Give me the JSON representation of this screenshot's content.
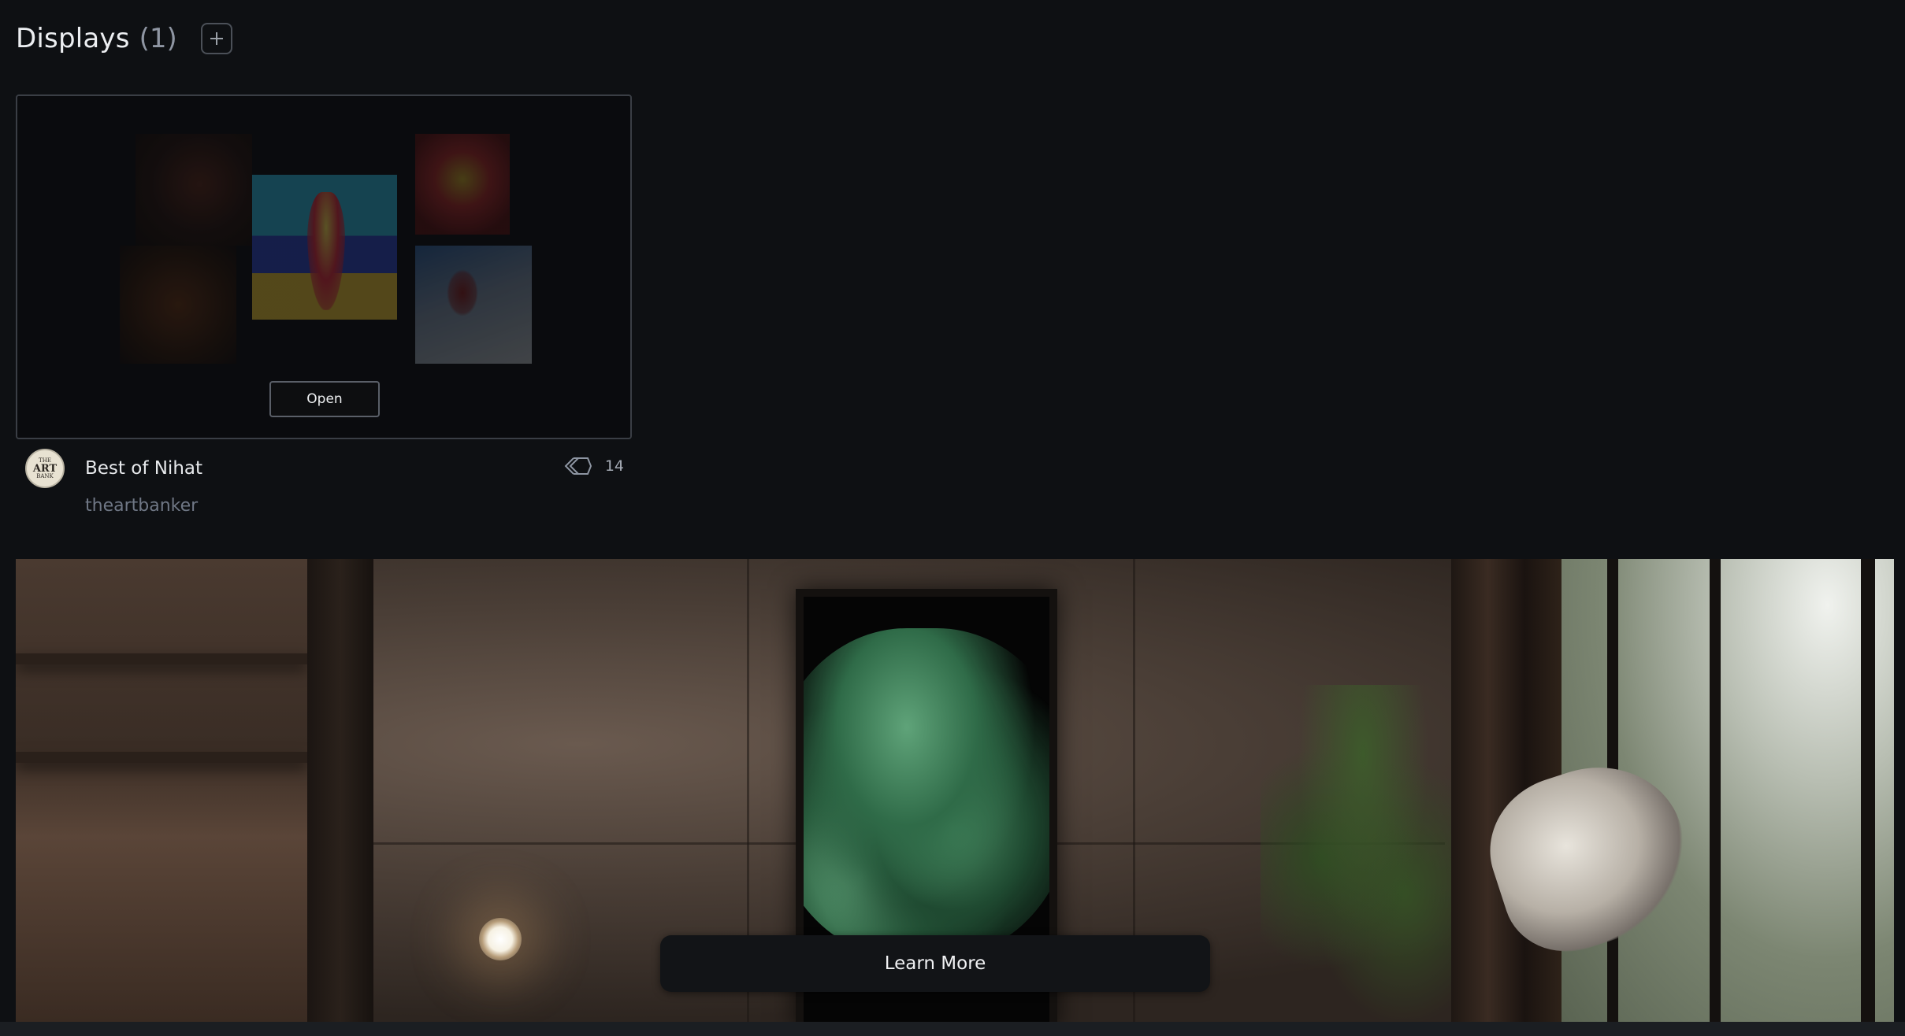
{
  "header": {
    "title": "Displays",
    "count": "(1)",
    "add_icon": "plus-icon"
  },
  "display_card": {
    "open_label": "Open",
    "name": "Best of Nihat",
    "owner": "theartbanker",
    "item_count": "14",
    "count_icon": "stack-chevrons-icon",
    "avatar": {
      "line1": "THE",
      "line2": "ART",
      "line3": "BANK"
    }
  },
  "banner": {
    "button_label": "Learn More"
  },
  "colors": {
    "background": "#0e1013",
    "muted_text": "#6f7785",
    "card_border": "#3a3e45"
  }
}
